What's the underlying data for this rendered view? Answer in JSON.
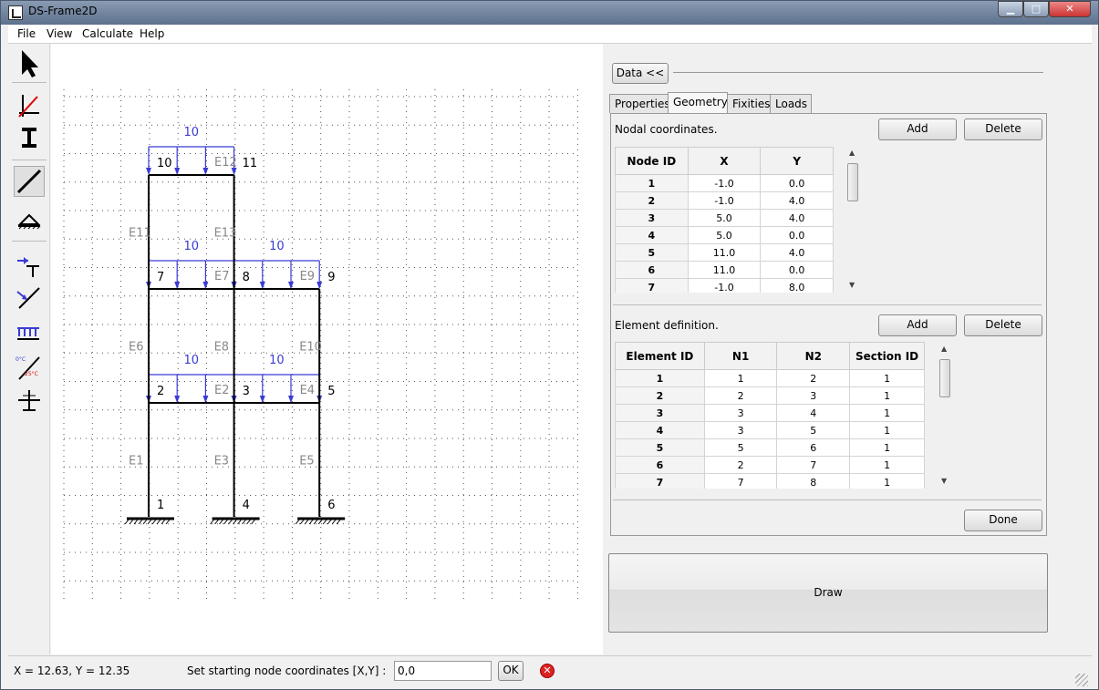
{
  "window": {
    "title": "DS-Frame2D",
    "min_label": "▁",
    "max_label": "□",
    "close_label": "✕"
  },
  "menu": [
    "File",
    "View",
    "Calculate",
    "Help"
  ],
  "toolbar": {
    "tools": [
      "select-tool",
      "axes-tool",
      "section-tool",
      "element-tool",
      "support-tool",
      "point-load-tool",
      "inclined-load-tool",
      "distributed-load-tool",
      "temperature-load-tool",
      "hinge-tool"
    ],
    "temp_labels": [
      "0°C",
      "25°C"
    ]
  },
  "right": {
    "data_button": "Data <<",
    "tabs": [
      "Properties",
      "Geometry",
      "Fixities",
      "Loads"
    ],
    "active_tab": "Geometry",
    "nodal": {
      "title": "Nodal coordinates.",
      "add": "Add",
      "delete": "Delete",
      "columns": [
        "Node ID",
        "X",
        "Y"
      ],
      "rows": [
        [
          "1",
          "-1.0",
          "0.0"
        ],
        [
          "2",
          "-1.0",
          "4.0"
        ],
        [
          "3",
          "5.0",
          "4.0"
        ],
        [
          "4",
          "5.0",
          "0.0"
        ],
        [
          "5",
          "11.0",
          "4.0"
        ],
        [
          "6",
          "11.0",
          "0.0"
        ],
        [
          "7",
          "-1.0",
          "8.0"
        ]
      ]
    },
    "elements": {
      "title": "Element definition.",
      "add": "Add",
      "delete": "Delete",
      "columns": [
        "Element ID",
        "N1",
        "N2",
        "Section ID"
      ],
      "rows": [
        [
          "1",
          "1",
          "2",
          "1"
        ],
        [
          "2",
          "2",
          "3",
          "1"
        ],
        [
          "3",
          "3",
          "4",
          "1"
        ],
        [
          "4",
          "3",
          "5",
          "1"
        ],
        [
          "5",
          "5",
          "6",
          "1"
        ],
        [
          "6",
          "2",
          "7",
          "1"
        ],
        [
          "7",
          "7",
          "8",
          "1"
        ]
      ]
    },
    "done": "Done",
    "draw": "Draw"
  },
  "status": {
    "cursor": "X = 12.63, Y = 12.35",
    "prompt": "Set starting node coordinates [X,Y] :",
    "input_value": "0,0",
    "ok": "OK",
    "cancel_glyph": "✕"
  },
  "frame": {
    "nodes": [
      {
        "id": "1",
        "x": -1,
        "y": 0
      },
      {
        "id": "2",
        "x": -1,
        "y": 4
      },
      {
        "id": "3",
        "x": 5,
        "y": 4
      },
      {
        "id": "4",
        "x": 5,
        "y": 0
      },
      {
        "id": "5",
        "x": 11,
        "y": 4
      },
      {
        "id": "6",
        "x": 11,
        "y": 0
      },
      {
        "id": "7",
        "x": -1,
        "y": 8
      },
      {
        "id": "8",
        "x": 5,
        "y": 8
      },
      {
        "id": "9",
        "x": 11,
        "y": 8
      },
      {
        "id": "10",
        "x": -1,
        "y": 12
      },
      {
        "id": "11",
        "x": 5,
        "y": 12
      }
    ],
    "elements": [
      {
        "id": "E1",
        "n1": "1",
        "n2": "2"
      },
      {
        "id": "E2",
        "n1": "2",
        "n2": "3"
      },
      {
        "id": "E3",
        "n1": "3",
        "n2": "4"
      },
      {
        "id": "E4",
        "n1": "3",
        "n2": "5"
      },
      {
        "id": "E5",
        "n1": "5",
        "n2": "6"
      },
      {
        "id": "E6",
        "n1": "2",
        "n2": "7"
      },
      {
        "id": "E7",
        "n1": "7",
        "n2": "8"
      },
      {
        "id": "E8",
        "n1": "3",
        "n2": "8"
      },
      {
        "id": "E9",
        "n1": "8",
        "n2": "9"
      },
      {
        "id": "E10",
        "n1": "5",
        "n2": "9"
      },
      {
        "id": "E11",
        "n1": "7",
        "n2": "10"
      },
      {
        "id": "E12",
        "n1": "10",
        "n2": "11"
      },
      {
        "id": "E13",
        "n1": "8",
        "n2": "11"
      }
    ],
    "supports": [
      "1",
      "4",
      "6"
    ],
    "loads": [
      {
        "element": "E2",
        "value": "10"
      },
      {
        "element": "E4",
        "value": "10"
      },
      {
        "element": "E7",
        "value": "10"
      },
      {
        "element": "E9",
        "value": "10"
      },
      {
        "element": "E12",
        "value": "10"
      }
    ],
    "colors": {
      "member": "#000000",
      "load": "#3a3ad6",
      "element_label": "#888888",
      "grid": "#555555"
    }
  }
}
